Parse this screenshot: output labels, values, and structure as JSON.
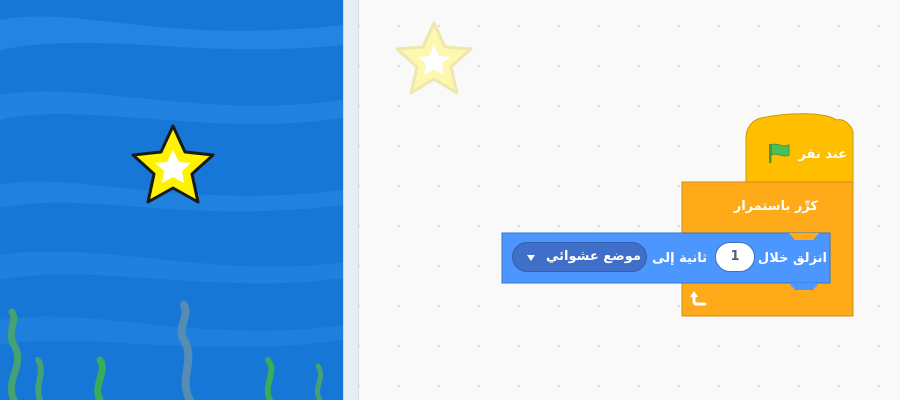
{
  "code_area": {
    "when_flag_clicked_label": "عند نقر",
    "forever_label": "كرِّر باستمرار",
    "glide": {
      "label_start": "انزلق خلال",
      "seconds_value": "1",
      "label_middle": "ثانية إلى",
      "target_option": "موضع عشوائي"
    }
  },
  "colors": {
    "stage_water": "#1677d6",
    "events_block": "#ffbf00",
    "control_block": "#ffab19",
    "motion_block": "#4c97ff",
    "star": "#ffeb3b",
    "flag": "#4cbf56"
  },
  "icons": [
    "green-flag-icon",
    "loop-arrow-icon",
    "dropdown-caret-icon",
    "star-sprite-icon"
  ]
}
